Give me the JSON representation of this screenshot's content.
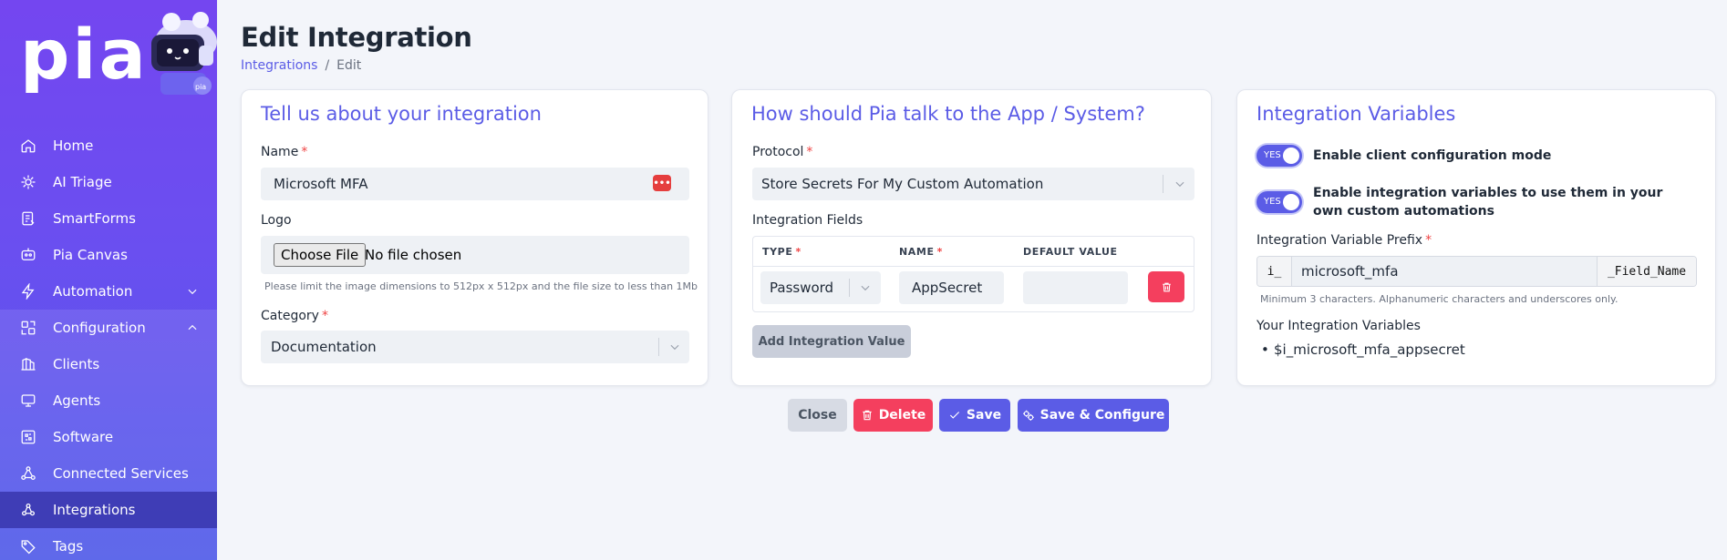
{
  "brand": {
    "logo_text": "pia",
    "mascot_badge": "pia"
  },
  "sidebar": {
    "items": [
      {
        "label": "Home",
        "icon": "home-icon"
      },
      {
        "label": "AI Triage",
        "icon": "ai-triage-icon"
      },
      {
        "label": "SmartForms",
        "icon": "smartforms-icon"
      },
      {
        "label": "Pia Canvas",
        "icon": "canvas-icon"
      },
      {
        "label": "Automation",
        "icon": "lightning-icon",
        "expand": "chevron-down-icon"
      },
      {
        "label": "Configuration",
        "icon": "configuration-icon",
        "expand": "chevron-up-icon"
      },
      {
        "label": "Clients",
        "icon": "clients-icon"
      },
      {
        "label": "Agents",
        "icon": "agents-icon"
      },
      {
        "label": "Software",
        "icon": "software-icon"
      },
      {
        "label": "Connected Services",
        "icon": "connected-services-icon"
      },
      {
        "label": "Integrations",
        "icon": "integrations-icon",
        "active": true
      },
      {
        "label": "Tags",
        "icon": "tag-icon"
      }
    ]
  },
  "header": {
    "title": "Edit Integration",
    "breadcrumb": {
      "parent": "Integrations",
      "separator": "/",
      "current": "Edit"
    }
  },
  "about_card": {
    "title": "Tell us about your integration",
    "name_label": "Name",
    "name_value": "Microsoft MFA",
    "logo_label": "Logo",
    "choose_file_label": "Choose File",
    "no_file_text": "No file chosen",
    "logo_hint": "Please limit the image dimensions to 512px x 512px and the file size to less than 1Mb",
    "category_label": "Category",
    "category_value": "Documentation",
    "required_mark": "*"
  },
  "talk_card": {
    "title": "How should Pia talk to the App / System?",
    "protocol_label": "Protocol",
    "protocol_value": "Store Secrets For My Custom Automation",
    "fields_label": "Integration Fields",
    "columns": {
      "type": "TYPE",
      "name": "NAME",
      "default": "DEFAULT VALUE"
    },
    "rows": [
      {
        "type": "Password",
        "name": "AppSecret",
        "default": ""
      }
    ],
    "add_button": "Add Integration Value",
    "required_mark": "*"
  },
  "vars_card": {
    "title": "Integration Variables",
    "toggle_text": "YES",
    "toggle1_label": "Enable client configuration mode",
    "toggle2_label": "Enable integration variables to use them in your own custom automations",
    "prefix_label": "Integration Variable Prefix",
    "prefix_start": "i_",
    "prefix_value": "microsoft_mfa",
    "prefix_end": "_Field_Name",
    "prefix_hint": "Minimum 3 characters. Alphanumeric characters and underscores only.",
    "your_vars_label": "Your Integration Variables",
    "variables": [
      "$i_microsoft_mfa_appsecret"
    ],
    "required_mark": "*"
  },
  "actions": {
    "close": "Close",
    "delete": "Delete",
    "save": "Save",
    "save_configure": "Save & Configure"
  },
  "colors": {
    "sidebar_top": "#7446f0",
    "sidebar_bottom": "#4d58e8",
    "accent": "#5b5ce6",
    "danger": "#f43f5e"
  }
}
